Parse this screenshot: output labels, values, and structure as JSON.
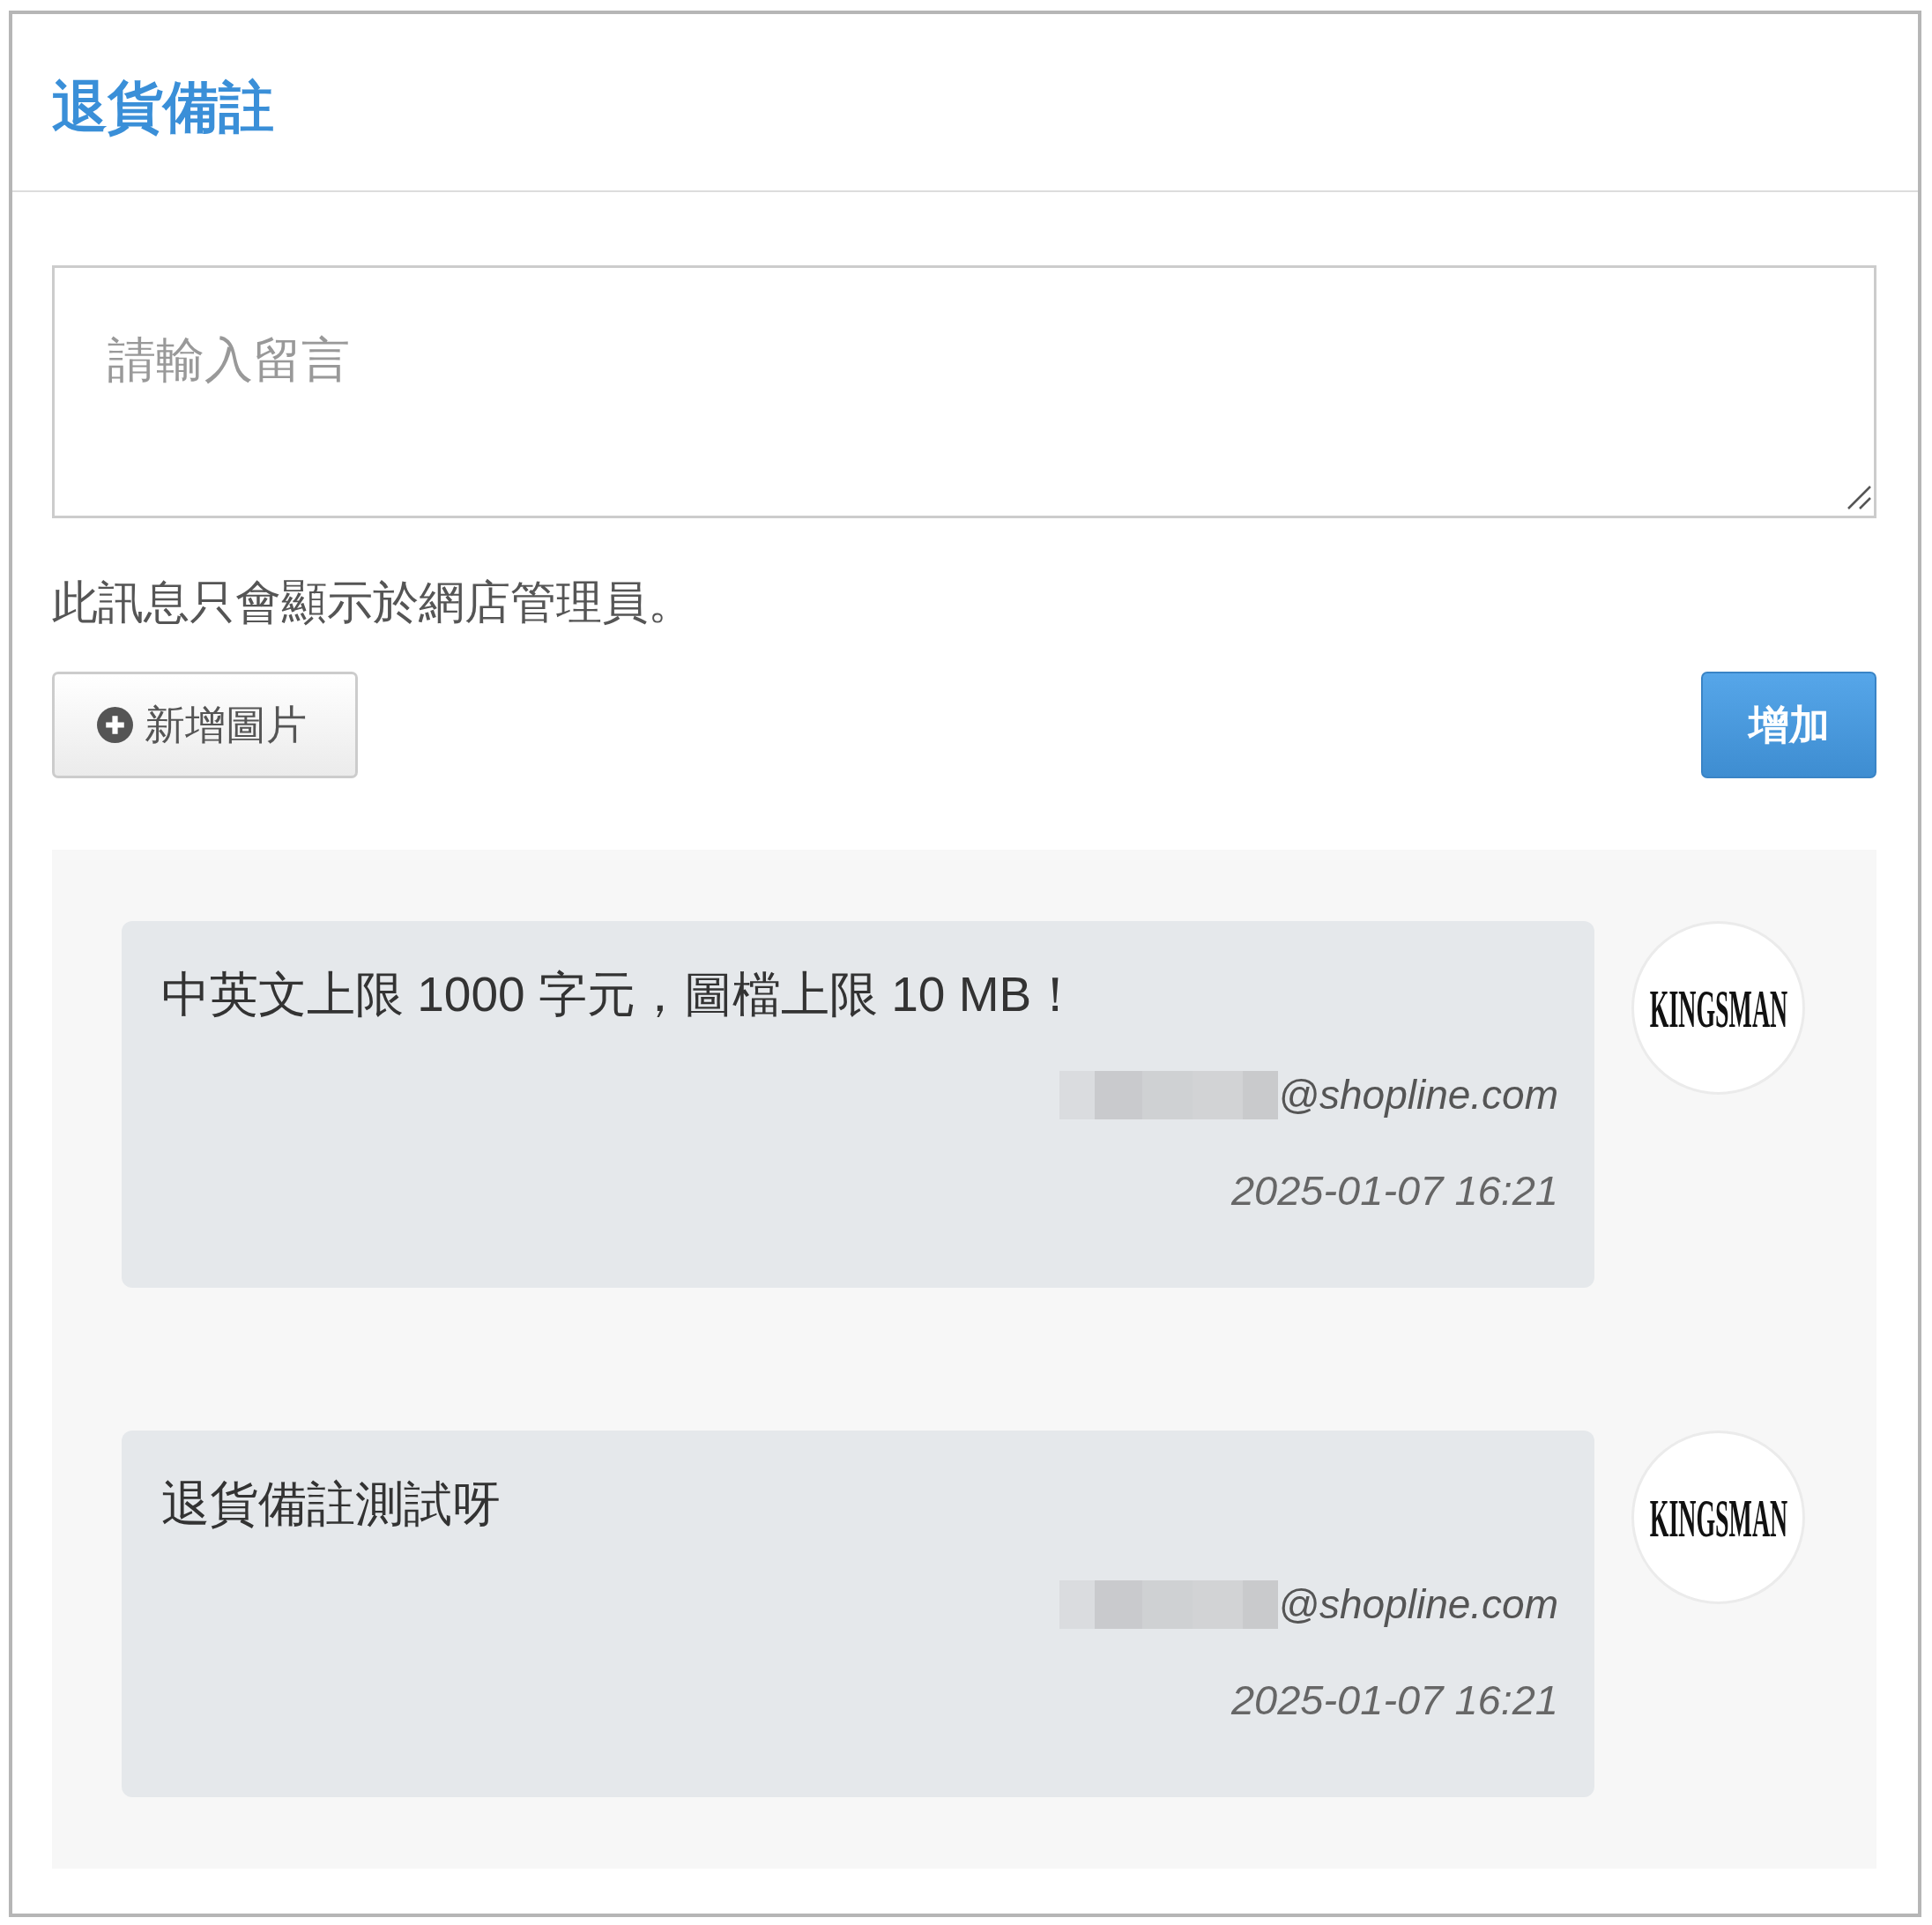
{
  "panel": {
    "title": "退貨備註"
  },
  "comment_field": {
    "placeholder": "請輸入留言"
  },
  "hint": "此訊息只會顯示於網店管理員。",
  "add_image_button": {
    "label": "新增圖片"
  },
  "submit_button": {
    "label": "增加"
  },
  "messages": [
    {
      "text": "中英文上限 1000 字元，圖檔上限 10 MB！",
      "email_redacted": true,
      "email": "@shopline.com",
      "time": "2025-01-07 16:21",
      "avatar_text": "KINGSMAN"
    },
    {
      "text": "退貨備註測試呀",
      "email_redacted": true,
      "email": "@shopline.com",
      "time": "2025-01-07 16:21",
      "avatar_text": "KINGSMAN"
    }
  ]
}
